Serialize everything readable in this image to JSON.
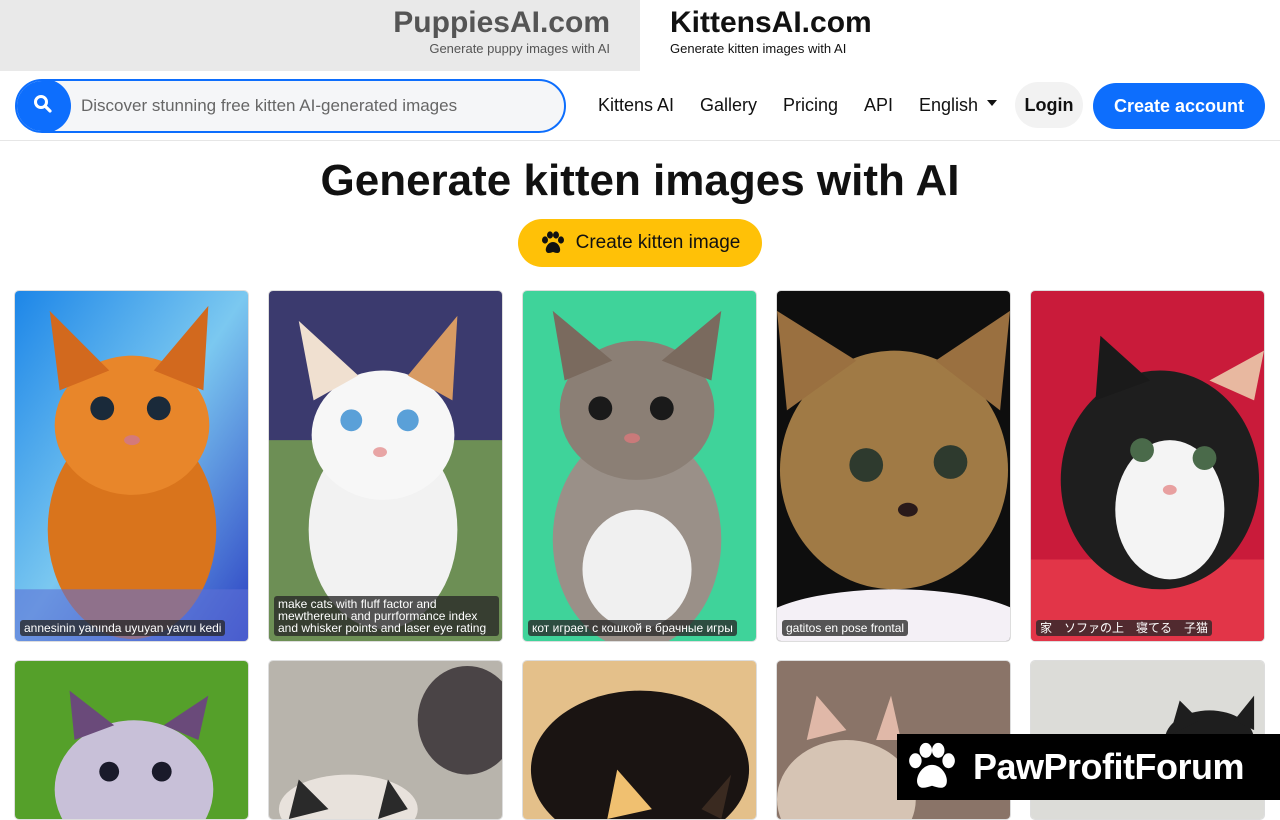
{
  "site_tabs": [
    {
      "title": "PuppiesAI.com",
      "subtitle": "Generate puppy images with AI"
    },
    {
      "title": "KittensAI.com",
      "subtitle": "Generate kitten images with AI"
    }
  ],
  "search": {
    "placeholder": "Discover stunning free kitten AI-generated images",
    "icon": "search-icon"
  },
  "nav": {
    "kittens_ai": "Kittens AI",
    "gallery": "Gallery",
    "pricing": "Pricing",
    "api": "API",
    "language": "English",
    "login": "Login",
    "create_account": "Create account"
  },
  "hero": {
    "title": "Generate kitten images with AI",
    "button": "Create kitten image",
    "button_icon": "paw-icon"
  },
  "gallery": [
    {
      "caption": "annesinin yanında uyuyan yavru kedi"
    },
    {
      "caption": "make cats with fluff factor and mewthereum and purrformance index and whisker points and laser eye rating"
    },
    {
      "caption": "кот играет с кошкой в брачные игры"
    },
    {
      "caption": "gatitos en pose frontal"
    },
    {
      "caption": "家　ソファの上　寝てる　子猫"
    },
    {
      "caption": ""
    },
    {
      "caption": ""
    },
    {
      "caption": ""
    },
    {
      "caption": ""
    },
    {
      "caption": ""
    }
  ],
  "watermark": {
    "text": "PawProfitForum",
    "icon": "paw-icon"
  },
  "colors": {
    "primary": "#0d6efd",
    "accent": "#ffc107",
    "tab_bg": "#e9e9e9"
  }
}
